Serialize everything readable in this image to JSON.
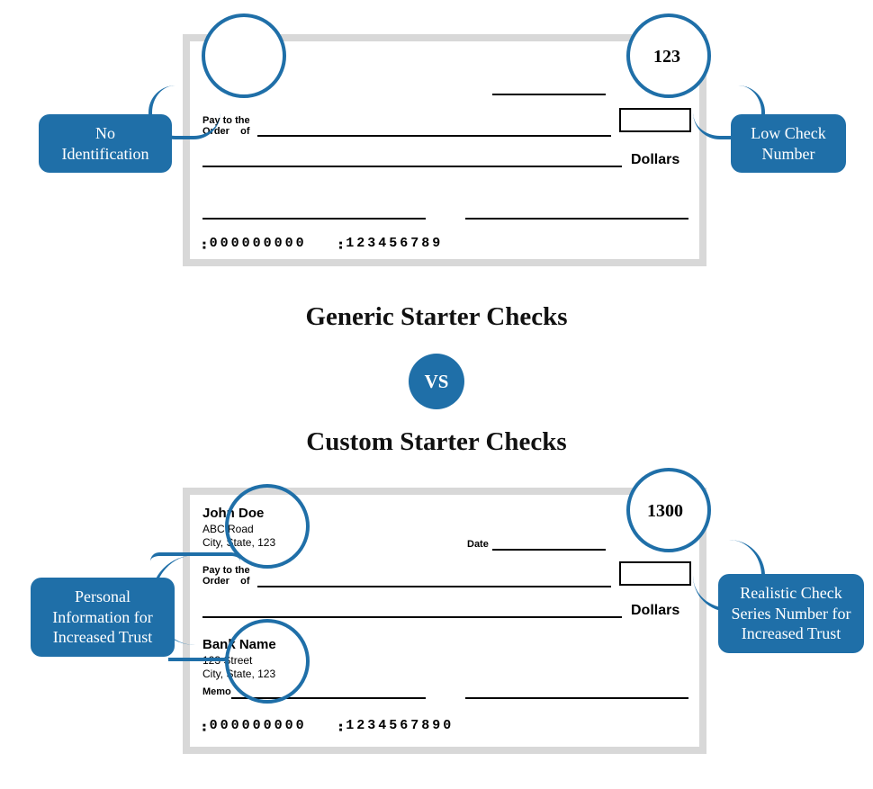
{
  "generic": {
    "check_number": "123",
    "pay_to_1": "Pay to the",
    "pay_to_2": "Order    of",
    "dollars": "Dollars",
    "micr_routing": "000000000",
    "micr_account": "123456789",
    "callout_left": "No Identification",
    "callout_right": "Low Check Number"
  },
  "middle": {
    "title_top": "Generic Starter Checks",
    "vs": "VS",
    "title_bottom": "Custom Starter Checks"
  },
  "custom": {
    "check_number": "1300",
    "name": "John Doe",
    "addr1": "ABC Road",
    "addr2": "City, State, 123",
    "date_label": "Date",
    "pay_to_1": "Pay to the",
    "pay_to_2": "Order    of",
    "dollars": "Dollars",
    "bank_name": "Bank Name",
    "bank_addr1": "123 Street",
    "bank_addr2": "City, State, 123",
    "memo": "Memo",
    "micr_routing": "000000000",
    "micr_account": "1234567890",
    "callout_left": "Personal Information for Increased Trust",
    "callout_right": "Realistic Check Series Number for Increased Trust"
  }
}
